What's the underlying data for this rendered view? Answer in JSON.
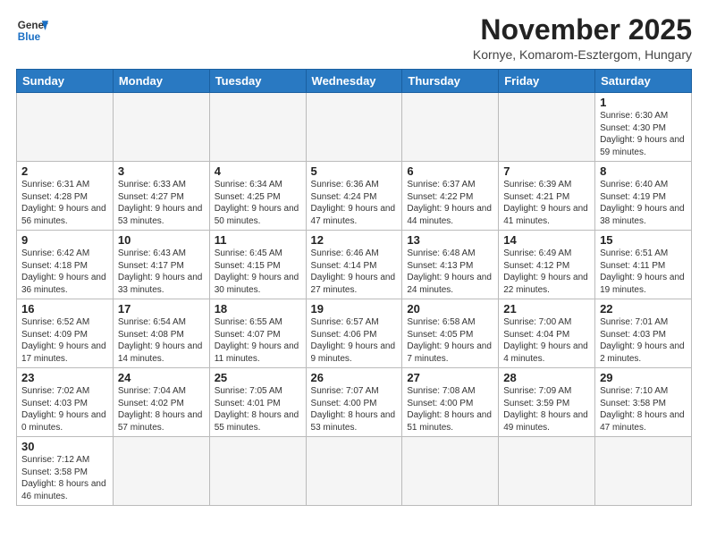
{
  "header": {
    "logo_general": "General",
    "logo_blue": "Blue",
    "month_title": "November 2025",
    "location": "Kornye, Komarom-Esztergom, Hungary"
  },
  "days_of_week": [
    "Sunday",
    "Monday",
    "Tuesday",
    "Wednesday",
    "Thursday",
    "Friday",
    "Saturday"
  ],
  "weeks": [
    [
      {
        "day": "",
        "info": ""
      },
      {
        "day": "",
        "info": ""
      },
      {
        "day": "",
        "info": ""
      },
      {
        "day": "",
        "info": ""
      },
      {
        "day": "",
        "info": ""
      },
      {
        "day": "",
        "info": ""
      },
      {
        "day": "1",
        "info": "Sunrise: 6:30 AM\nSunset: 4:30 PM\nDaylight: 9 hours\nand 59 minutes."
      }
    ],
    [
      {
        "day": "2",
        "info": "Sunrise: 6:31 AM\nSunset: 4:28 PM\nDaylight: 9 hours\nand 56 minutes."
      },
      {
        "day": "3",
        "info": "Sunrise: 6:33 AM\nSunset: 4:27 PM\nDaylight: 9 hours\nand 53 minutes."
      },
      {
        "day": "4",
        "info": "Sunrise: 6:34 AM\nSunset: 4:25 PM\nDaylight: 9 hours\nand 50 minutes."
      },
      {
        "day": "5",
        "info": "Sunrise: 6:36 AM\nSunset: 4:24 PM\nDaylight: 9 hours\nand 47 minutes."
      },
      {
        "day": "6",
        "info": "Sunrise: 6:37 AM\nSunset: 4:22 PM\nDaylight: 9 hours\nand 44 minutes."
      },
      {
        "day": "7",
        "info": "Sunrise: 6:39 AM\nSunset: 4:21 PM\nDaylight: 9 hours\nand 41 minutes."
      },
      {
        "day": "8",
        "info": "Sunrise: 6:40 AM\nSunset: 4:19 PM\nDaylight: 9 hours\nand 38 minutes."
      }
    ],
    [
      {
        "day": "9",
        "info": "Sunrise: 6:42 AM\nSunset: 4:18 PM\nDaylight: 9 hours\nand 36 minutes."
      },
      {
        "day": "10",
        "info": "Sunrise: 6:43 AM\nSunset: 4:17 PM\nDaylight: 9 hours\nand 33 minutes."
      },
      {
        "day": "11",
        "info": "Sunrise: 6:45 AM\nSunset: 4:15 PM\nDaylight: 9 hours\nand 30 minutes."
      },
      {
        "day": "12",
        "info": "Sunrise: 6:46 AM\nSunset: 4:14 PM\nDaylight: 9 hours\nand 27 minutes."
      },
      {
        "day": "13",
        "info": "Sunrise: 6:48 AM\nSunset: 4:13 PM\nDaylight: 9 hours\nand 24 minutes."
      },
      {
        "day": "14",
        "info": "Sunrise: 6:49 AM\nSunset: 4:12 PM\nDaylight: 9 hours\nand 22 minutes."
      },
      {
        "day": "15",
        "info": "Sunrise: 6:51 AM\nSunset: 4:11 PM\nDaylight: 9 hours\nand 19 minutes."
      }
    ],
    [
      {
        "day": "16",
        "info": "Sunrise: 6:52 AM\nSunset: 4:09 PM\nDaylight: 9 hours\nand 17 minutes."
      },
      {
        "day": "17",
        "info": "Sunrise: 6:54 AM\nSunset: 4:08 PM\nDaylight: 9 hours\nand 14 minutes."
      },
      {
        "day": "18",
        "info": "Sunrise: 6:55 AM\nSunset: 4:07 PM\nDaylight: 9 hours\nand 11 minutes."
      },
      {
        "day": "19",
        "info": "Sunrise: 6:57 AM\nSunset: 4:06 PM\nDaylight: 9 hours\nand 9 minutes."
      },
      {
        "day": "20",
        "info": "Sunrise: 6:58 AM\nSunset: 4:05 PM\nDaylight: 9 hours\nand 7 minutes."
      },
      {
        "day": "21",
        "info": "Sunrise: 7:00 AM\nSunset: 4:04 PM\nDaylight: 9 hours\nand 4 minutes."
      },
      {
        "day": "22",
        "info": "Sunrise: 7:01 AM\nSunset: 4:03 PM\nDaylight: 9 hours\nand 2 minutes."
      }
    ],
    [
      {
        "day": "23",
        "info": "Sunrise: 7:02 AM\nSunset: 4:03 PM\nDaylight: 9 hours\nand 0 minutes."
      },
      {
        "day": "24",
        "info": "Sunrise: 7:04 AM\nSunset: 4:02 PM\nDaylight: 8 hours\nand 57 minutes."
      },
      {
        "day": "25",
        "info": "Sunrise: 7:05 AM\nSunset: 4:01 PM\nDaylight: 8 hours\nand 55 minutes."
      },
      {
        "day": "26",
        "info": "Sunrise: 7:07 AM\nSunset: 4:00 PM\nDaylight: 8 hours\nand 53 minutes."
      },
      {
        "day": "27",
        "info": "Sunrise: 7:08 AM\nSunset: 4:00 PM\nDaylight: 8 hours\nand 51 minutes."
      },
      {
        "day": "28",
        "info": "Sunrise: 7:09 AM\nSunset: 3:59 PM\nDaylight: 8 hours\nand 49 minutes."
      },
      {
        "day": "29",
        "info": "Sunrise: 7:10 AM\nSunset: 3:58 PM\nDaylight: 8 hours\nand 47 minutes."
      }
    ],
    [
      {
        "day": "30",
        "info": "Sunrise: 7:12 AM\nSunset: 3:58 PM\nDaylight: 8 hours\nand 46 minutes."
      },
      {
        "day": "",
        "info": ""
      },
      {
        "day": "",
        "info": ""
      },
      {
        "day": "",
        "info": ""
      },
      {
        "day": "",
        "info": ""
      },
      {
        "day": "",
        "info": ""
      },
      {
        "day": "",
        "info": ""
      }
    ]
  ]
}
